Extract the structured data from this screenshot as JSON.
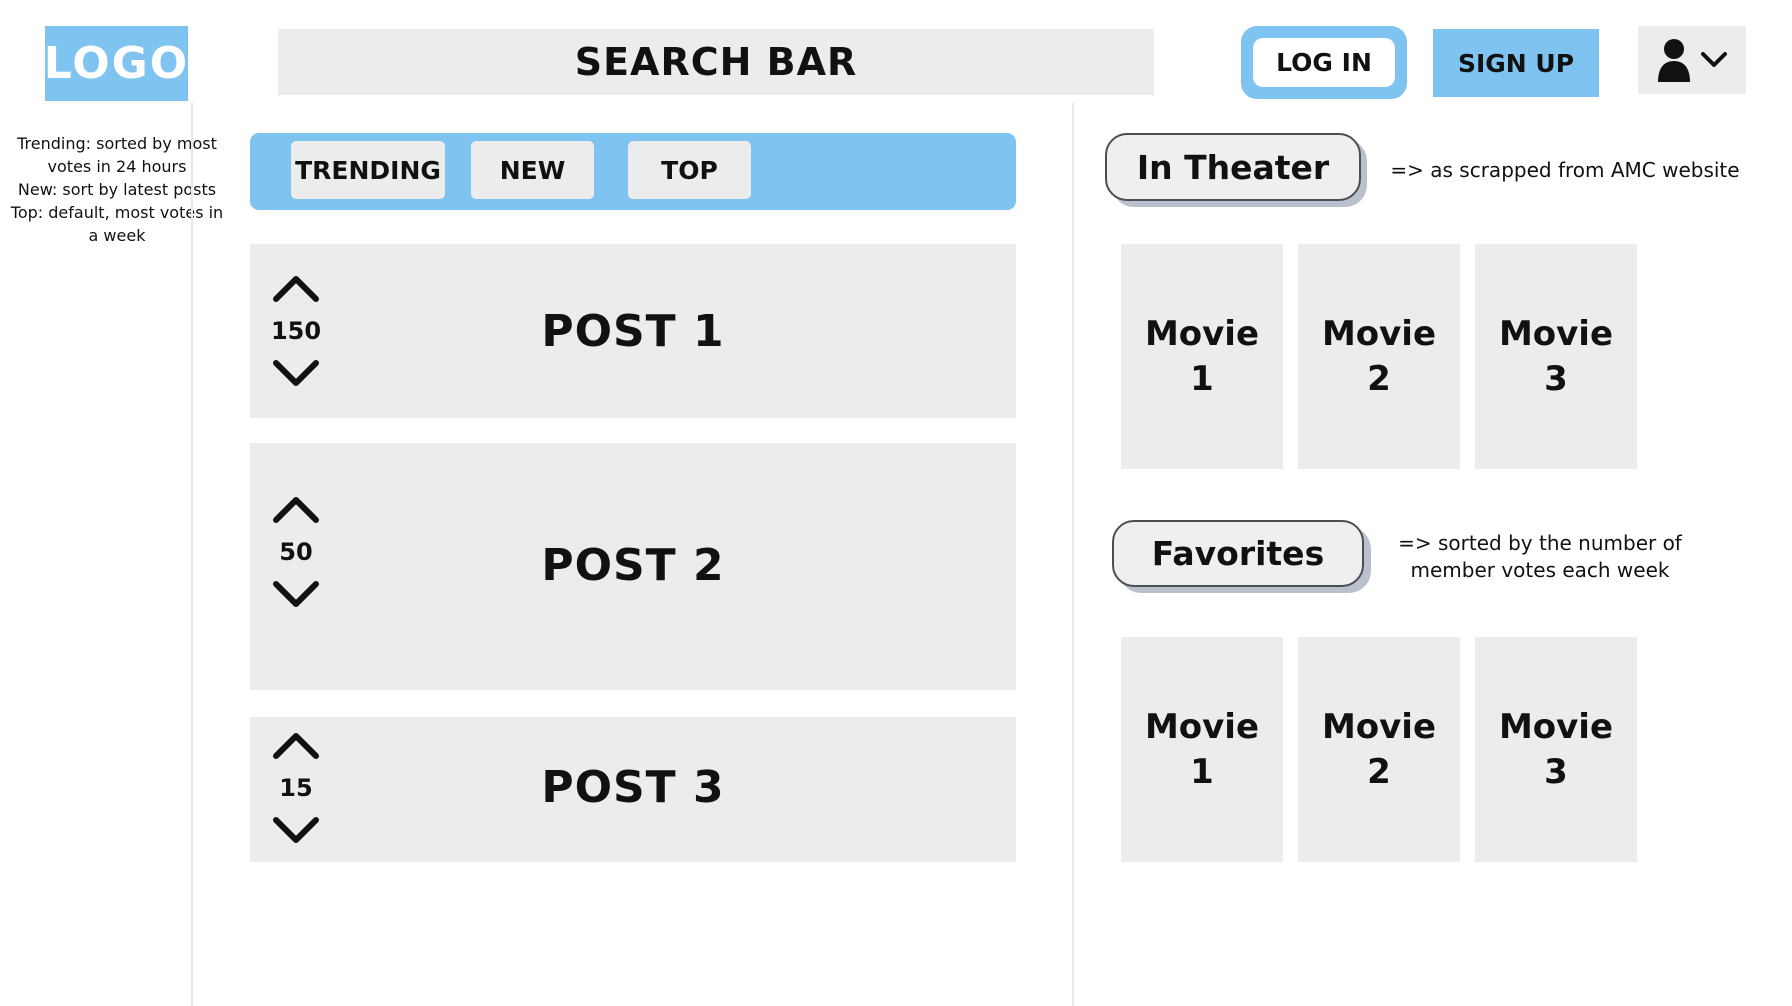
{
  "header": {
    "logo": "LOGO",
    "search_label": "SEARCH BAR",
    "login_label": "LOG IN",
    "signup_label": "SIGN UP"
  },
  "sort_note": {
    "lines": [
      "Trending: sorted by most",
      "votes in 24 hours",
      "New: sort by latest posts",
      "Top: default, most votes in",
      "a week"
    ]
  },
  "tabs": [
    {
      "label": "TRENDING"
    },
    {
      "label": "NEW"
    },
    {
      "label": "TOP"
    }
  ],
  "posts": [
    {
      "title": "POST 1",
      "votes": "150"
    },
    {
      "title": "POST 2",
      "votes": "50"
    },
    {
      "title": "POST 3",
      "votes": "15"
    }
  ],
  "in_theater": {
    "label": "In Theater",
    "note": "=> as scrapped from AMC website",
    "movies": [
      {
        "label": "Movie\n1"
      },
      {
        "label": "Movie\n2"
      },
      {
        "label": "Movie\n3"
      }
    ]
  },
  "favorites": {
    "label": "Favorites",
    "note_lines": [
      "=> sorted by the number of",
      "member votes each week"
    ],
    "movies": [
      {
        "label": "Movie\n1"
      },
      {
        "label": "Movie\n2"
      },
      {
        "label": "Movie\n3"
      }
    ]
  },
  "icons": {
    "account": "user-icon",
    "dropdown": "chevron-down-icon",
    "upvote": "chevron-up-icon",
    "downvote": "chevron-down-icon"
  },
  "colors": {
    "accent": "#7fc3f0",
    "panel": "#ececec"
  }
}
